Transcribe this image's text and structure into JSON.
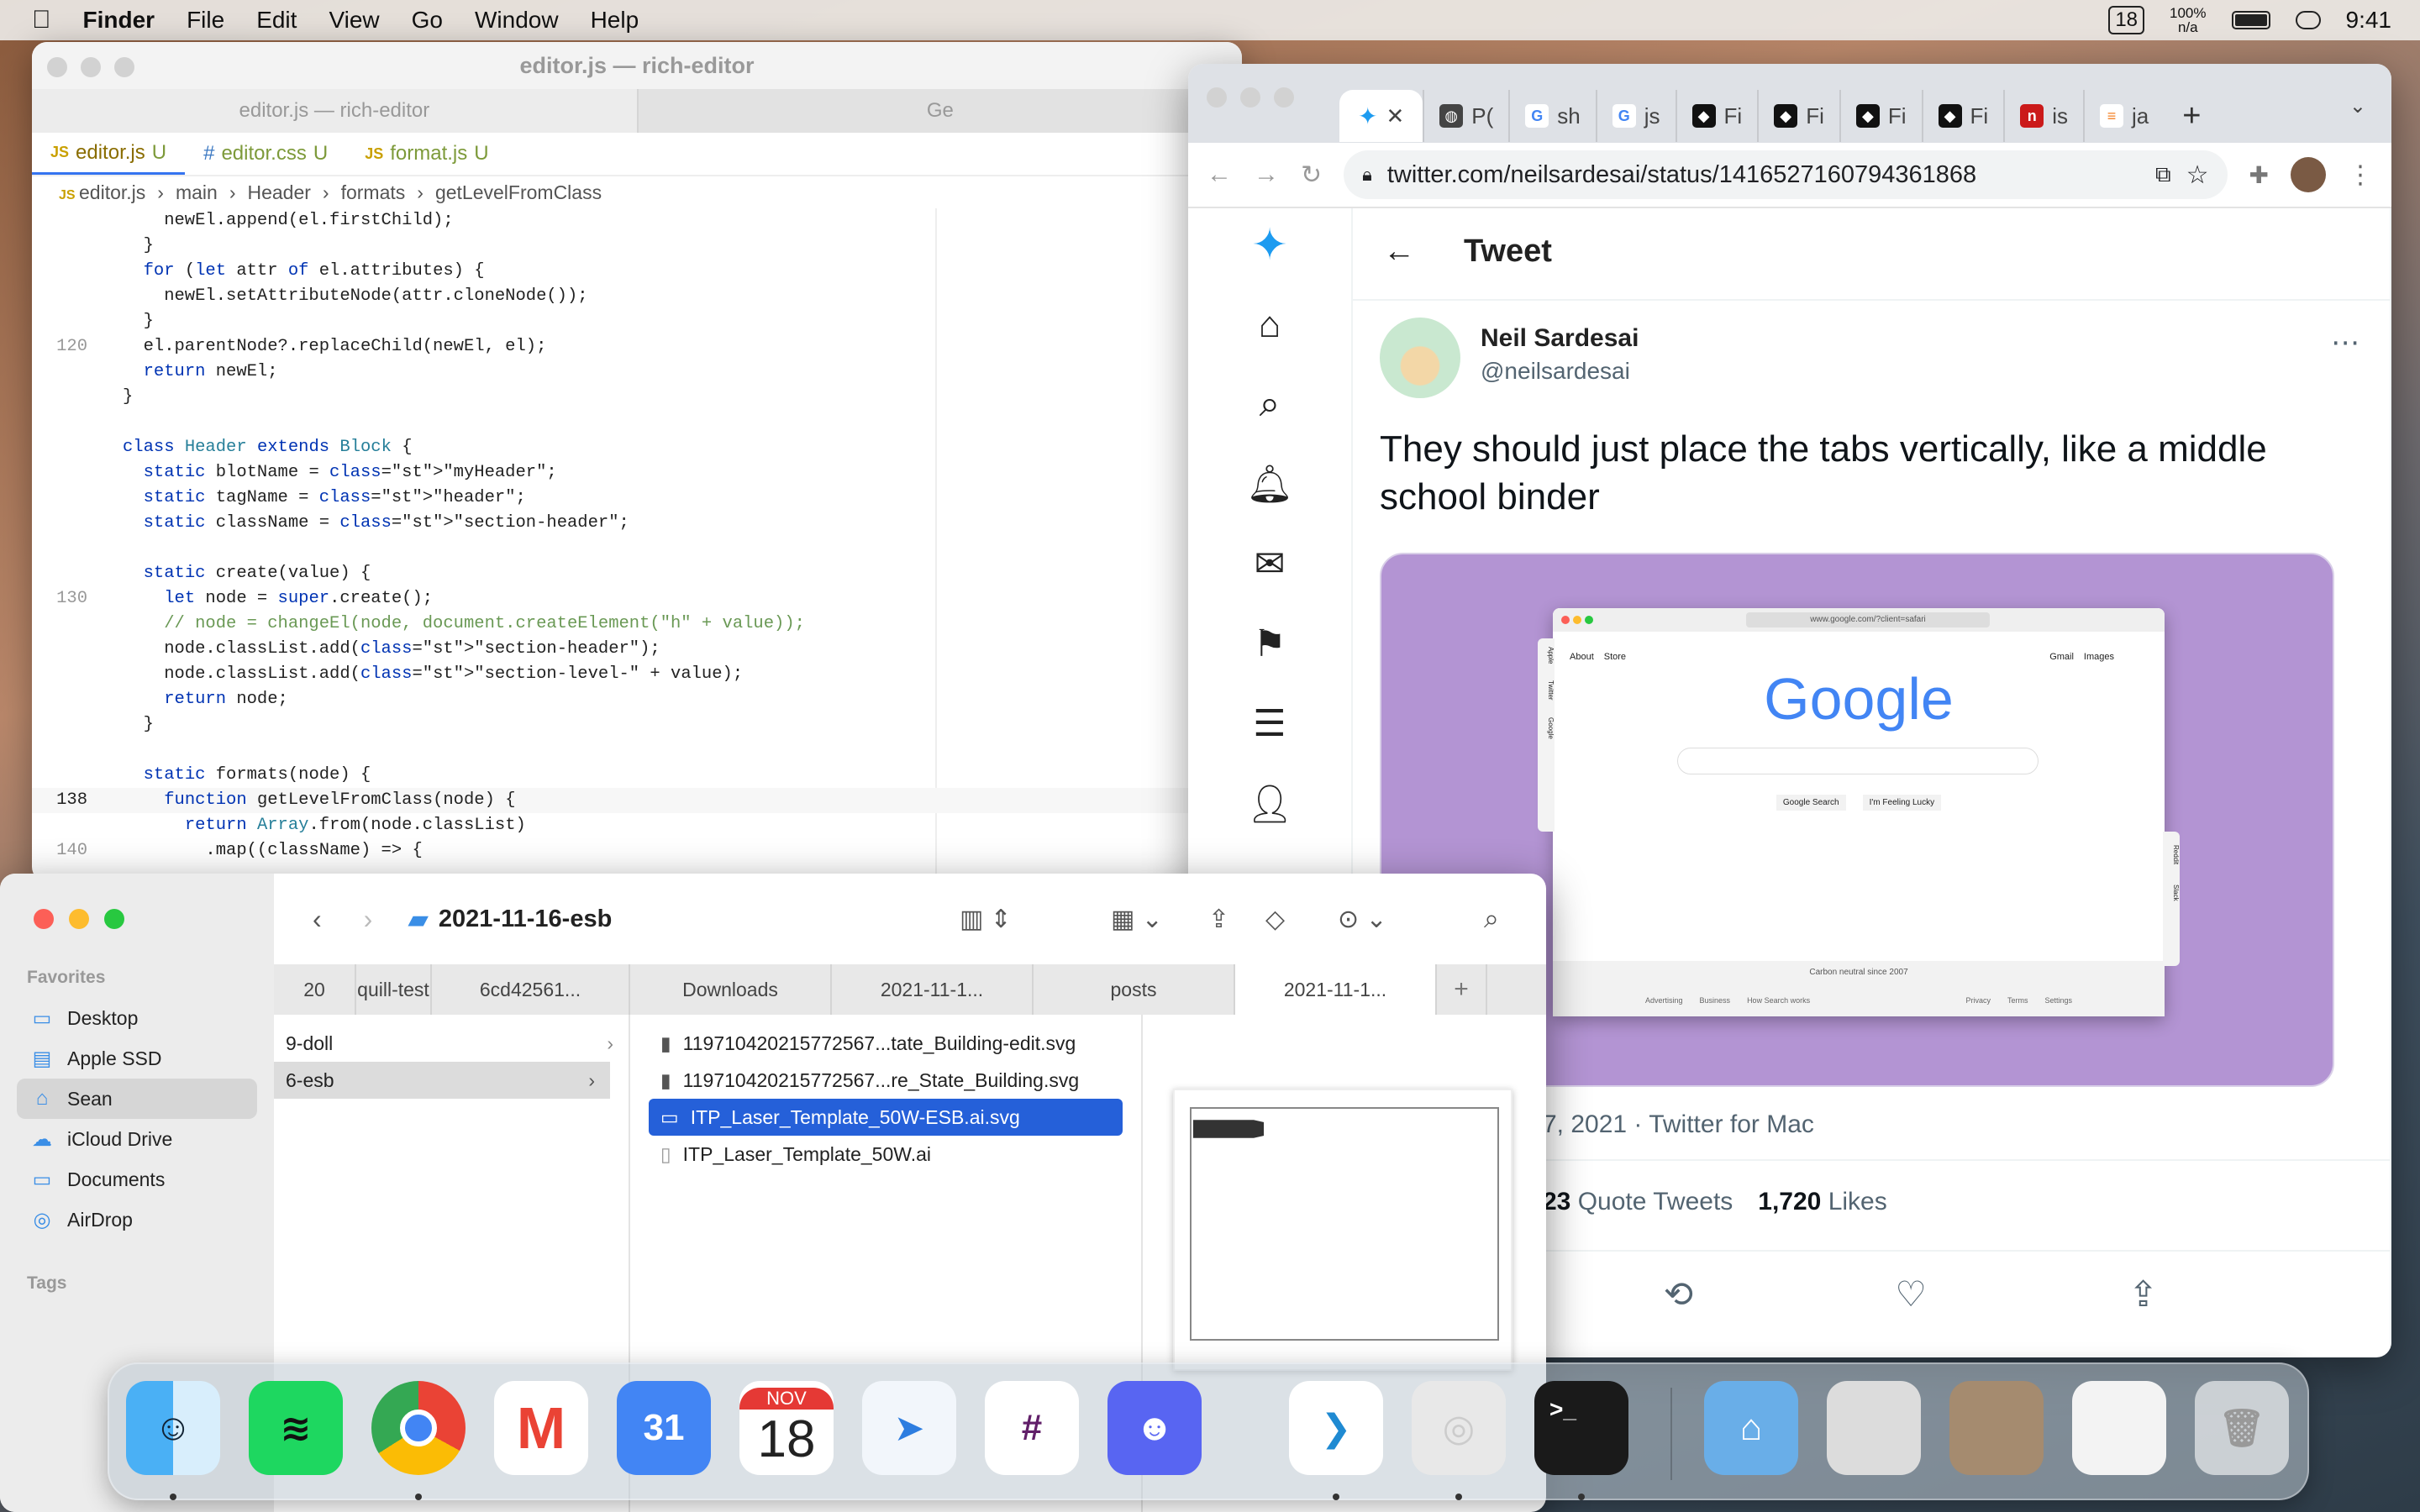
{
  "menubar": {
    "app": "Finder",
    "items": [
      "File",
      "Edit",
      "View",
      "Go",
      "Window",
      "Help"
    ],
    "date_badge": "18",
    "battery": "100%",
    "battery_sub": "n/a",
    "time": "9:41"
  },
  "editor": {
    "title": "editor.js — rich-editor",
    "subtitle": "editor.js — rich-editor",
    "subtitle2": "Ge",
    "tabs": [
      {
        "label": "editor.js",
        "status": "U"
      },
      {
        "label": "editor.css",
        "status": "U"
      },
      {
        "label": "format.js",
        "status": "U"
      }
    ],
    "breadcrumb": [
      "editor.js",
      "main",
      "Header",
      "formats",
      "getLevelFromClass"
    ],
    "lines": [
      {
        "n": "",
        "t": "    newEl.append(el.firstChild);"
      },
      {
        "n": "",
        "t": "  }"
      },
      {
        "n": "",
        "t": "  for (let attr of el.attributes) {"
      },
      {
        "n": "",
        "t": "    newEl.setAttributeNode(attr.cloneNode());"
      },
      {
        "n": "",
        "t": "  }"
      },
      {
        "n": "120",
        "t": "  el.parentNode?.replaceChild(newEl, el);"
      },
      {
        "n": "",
        "t": "  return newEl;"
      },
      {
        "n": "",
        "t": "}"
      },
      {
        "n": "",
        "t": ""
      },
      {
        "n": "",
        "t": "class Header extends Block {"
      },
      {
        "n": "",
        "t": "  static blotName = \"myHeader\";"
      },
      {
        "n": "",
        "t": "  static tagName = \"header\";"
      },
      {
        "n": "",
        "t": "  static className = \"section-header\";"
      },
      {
        "n": "",
        "t": ""
      },
      {
        "n": "",
        "t": "  static create(value) {"
      },
      {
        "n": "130",
        "t": "    let node = super.create();"
      },
      {
        "n": "",
        "t": "    // node = changeEl(node, document.createElement(\"h\" + value));"
      },
      {
        "n": "",
        "t": "    node.classList.add(\"section-header\");"
      },
      {
        "n": "",
        "t": "    node.classList.add(\"section-level-\" + value);"
      },
      {
        "n": "",
        "t": "    return node;"
      },
      {
        "n": "",
        "t": "  }"
      },
      {
        "n": "",
        "t": ""
      },
      {
        "n": "",
        "t": "  static formats(node) {"
      },
      {
        "n": "138",
        "t": "    function getLevelFromClass(node) {"
      },
      {
        "n": "",
        "t": "      return Array.from(node.classList)"
      },
      {
        "n": "140",
        "t": "        .map((className) => {"
      }
    ]
  },
  "chrome": {
    "tabs": [
      "",
      "P(",
      "sh",
      "js",
      "Fi",
      "Fi",
      "Fi",
      "Fi",
      "is",
      "ja"
    ],
    "url": "twitter.com/neilsardesai/status/1416527160794361868"
  },
  "tweet": {
    "header": "Tweet",
    "name": "Neil Sardesai",
    "handle": "@neilsardesai",
    "text": "They should just place the tabs vertically, like a middle school binder",
    "meta": "7, 2021 · Twitter for Mac",
    "quotes": "23",
    "quotes_label": "Quote Tweets",
    "likes": "1,720",
    "likes_label": "Likes",
    "image": {
      "url": "www.google.com/?client=safari",
      "left_links": [
        "About",
        "Store"
      ],
      "right_links": [
        "Gmail",
        "Images"
      ],
      "logo": "Google",
      "buttons": [
        "Google Search",
        "I'm Feeling Lucky"
      ],
      "carbon": "Carbon neutral since 2007",
      "footer_left": [
        "Advertising",
        "Business",
        "How Search works"
      ],
      "footer_right": [
        "Privacy",
        "Terms",
        "Settings"
      ],
      "side_tabs": [
        "Apple",
        "Twitter",
        "Google"
      ],
      "right_tabs": [
        "Reddit",
        "Slack"
      ]
    }
  },
  "finder": {
    "folder": "2021-11-16-esb",
    "favorites_label": "Favorites",
    "tags_label": "Tags",
    "sidebar": [
      "Desktop",
      "Apple SSD",
      "Sean",
      "iCloud Drive",
      "Documents",
      "AirDrop"
    ],
    "tabs": [
      "20",
      "quill-test",
      "6cd42561...",
      "Downloads",
      "2021-11-1...",
      "posts",
      "2021-11-1..."
    ],
    "col1": [
      "9-doll",
      "6-esb"
    ],
    "col2": [
      "119710420215772567...tate_Building-edit.svg",
      "119710420215772567...re_State_Building.svg",
      "ITP_Laser_Template_50W-ESB.ai.svg",
      "ITP_Laser_Template_50W.ai"
    ]
  },
  "dock": {
    "calendar_day": "31",
    "calendar2_month": "NOV",
    "calendar2_day": "18"
  }
}
